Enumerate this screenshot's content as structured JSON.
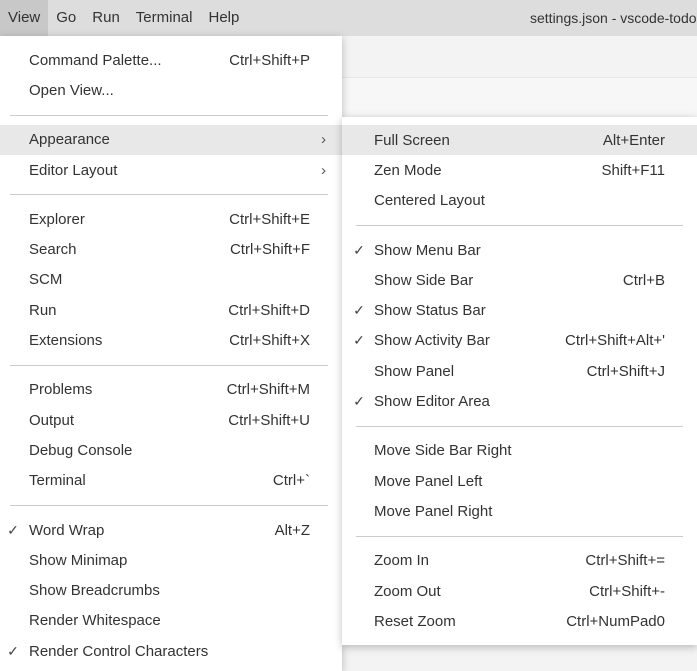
{
  "menubar": {
    "items": [
      "View",
      "Go",
      "Run",
      "Terminal",
      "Help"
    ],
    "window_title": "settings.json - vscode-todo"
  },
  "view_menu": {
    "groups": [
      [
        {
          "label": "Command Palette...",
          "shortcut": "Ctrl+Shift+P"
        },
        {
          "label": "Open View...",
          "shortcut": ""
        }
      ],
      [
        {
          "label": "Appearance",
          "shortcut": "",
          "submenu": true,
          "highlighted": true
        },
        {
          "label": "Editor Layout",
          "shortcut": "",
          "submenu": true
        }
      ],
      [
        {
          "label": "Explorer",
          "shortcut": "Ctrl+Shift+E"
        },
        {
          "label": "Search",
          "shortcut": "Ctrl+Shift+F"
        },
        {
          "label": "SCM",
          "shortcut": ""
        },
        {
          "label": "Run",
          "shortcut": "Ctrl+Shift+D"
        },
        {
          "label": "Extensions",
          "shortcut": "Ctrl+Shift+X"
        }
      ],
      [
        {
          "label": "Problems",
          "shortcut": "Ctrl+Shift+M"
        },
        {
          "label": "Output",
          "shortcut": "Ctrl+Shift+U"
        },
        {
          "label": "Debug Console",
          "shortcut": ""
        },
        {
          "label": "Terminal",
          "shortcut": "Ctrl+`"
        }
      ],
      [
        {
          "label": "Word Wrap",
          "shortcut": "Alt+Z",
          "checked": true
        },
        {
          "label": "Show Minimap",
          "shortcut": ""
        },
        {
          "label": "Show Breadcrumbs",
          "shortcut": ""
        },
        {
          "label": "Render Whitespace",
          "shortcut": ""
        },
        {
          "label": "Render Control Characters",
          "shortcut": "",
          "checked": true
        }
      ]
    ]
  },
  "appearance_submenu": {
    "groups": [
      [
        {
          "label": "Full Screen",
          "shortcut": "Alt+Enter",
          "highlighted": true
        },
        {
          "label": "Zen Mode",
          "shortcut": "Shift+F11"
        },
        {
          "label": "Centered Layout",
          "shortcut": ""
        }
      ],
      [
        {
          "label": "Show Menu Bar",
          "shortcut": "",
          "checked": true
        },
        {
          "label": "Show Side Bar",
          "shortcut": "Ctrl+B"
        },
        {
          "label": "Show Status Bar",
          "shortcut": "",
          "checked": true
        },
        {
          "label": "Show Activity Bar",
          "shortcut": "Ctrl+Shift+Alt+'",
          "checked": true
        },
        {
          "label": "Show Panel",
          "shortcut": "Ctrl+Shift+J"
        },
        {
          "label": "Show Editor Area",
          "shortcut": "",
          "checked": true
        }
      ],
      [
        {
          "label": "Move Side Bar Right",
          "shortcut": ""
        },
        {
          "label": "Move Panel Left",
          "shortcut": ""
        },
        {
          "label": "Move Panel Right",
          "shortcut": ""
        }
      ],
      [
        {
          "label": "Zoom In",
          "shortcut": "Ctrl+Shift+="
        },
        {
          "label": "Zoom Out",
          "shortcut": "Ctrl+Shift+-"
        },
        {
          "label": "Reset Zoom",
          "shortcut": "Ctrl+NumPad0"
        }
      ]
    ]
  },
  "icons": {
    "check": "check-icon",
    "submenu_arrow": "chevron-right-icon"
  },
  "colors": {
    "menubar": "#dddddd",
    "highlight": "#e8e8e8",
    "menu_bg": "#ffffff"
  }
}
